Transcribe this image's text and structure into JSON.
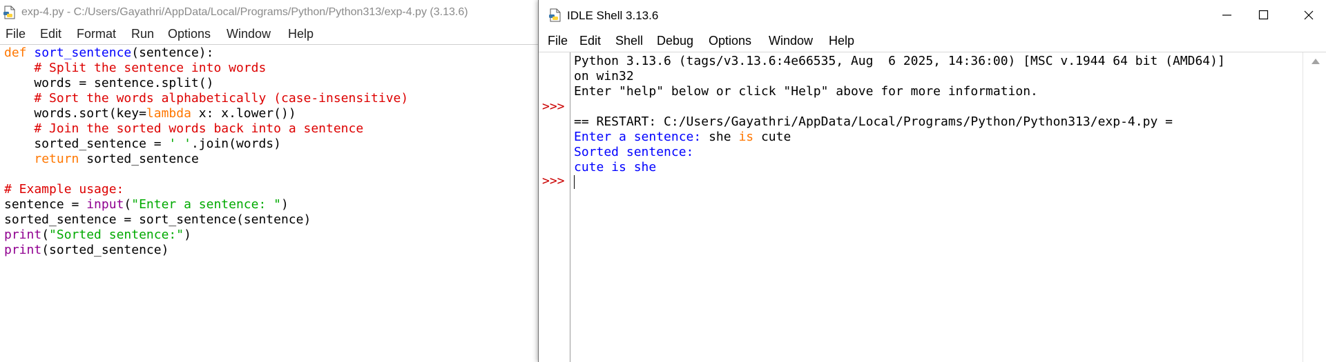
{
  "editor": {
    "title": "exp-4.py - C:/Users/Gayathri/AppData/Local/Programs/Python/Python313/exp-4.py (3.13.6)",
    "menu": [
      "File",
      "Edit",
      "Format",
      "Run",
      "Options",
      "Window",
      "Help"
    ],
    "code": {
      "l1_kw": "def",
      "l1_sp": " ",
      "l1_fn": "sort_sentence",
      "l1_rest": "(sentence):",
      "l2_indent": "    ",
      "l2_comment": "# Split the sentence into words",
      "l3": "    words = sentence.split()",
      "l4_indent": "    ",
      "l4_comment": "# Sort the words alphabetically (case-insensitive)",
      "l5_a": "    words.sort(key=",
      "l5_kw": "lambda",
      "l5_b": " x: x.lower())",
      "l6_indent": "    ",
      "l6_comment": "# Join the sorted words back into a sentence",
      "l7_a": "    sorted_sentence = ",
      "l7_str": "' '",
      "l7_b": ".join(words)",
      "l8_indent": "    ",
      "l8_kw": "return",
      "l8_b": " sorted_sentence",
      "l10_comment": "# Example usage:",
      "l11_a": "sentence = ",
      "l11_bi": "input",
      "l11_b": "(",
      "l11_str": "\"Enter a sentence: \"",
      "l11_c": ")",
      "l12": "sorted_sentence = sort_sentence(sentence)",
      "l13_bi": "print",
      "l13_a": "(",
      "l13_str": "\"Sorted sentence:\"",
      "l13_b": ")",
      "l14_bi": "print",
      "l14_a": "(sorted_sentence)"
    }
  },
  "shell": {
    "title": "IDLE Shell 3.13.6",
    "menu": [
      "File",
      "Edit",
      "Shell",
      "Debug",
      "Options",
      "Window",
      "Help"
    ],
    "prompt": ">>>",
    "banner1": "Python 3.13.6 (tags/v3.13.6:4e66535, Aug  6 2025, 14:36:00) [MSC v.1944 64 bit (AMD64)]",
    "banner2": "on win32",
    "banner3": "Enter \"help\" below or click \"Help\" above for more information.",
    "restart": "== RESTART: C:/Users/Gayathri/AppData/Local/Programs/Python/Python313/exp-4.py =",
    "input_prompt": "Enter a sentence: ",
    "input_a": "she ",
    "input_kw": "is",
    "input_b": " cute",
    "out1": "Sorted sentence:",
    "out2": "cute is she"
  },
  "colors": {
    "keyword": "#ff7700",
    "function_name": "#0000ff",
    "comment": "#dd0000",
    "string": "#00aa00",
    "builtin": "#900090",
    "prompt": "#ca0000",
    "stdout": "#0000ff"
  }
}
